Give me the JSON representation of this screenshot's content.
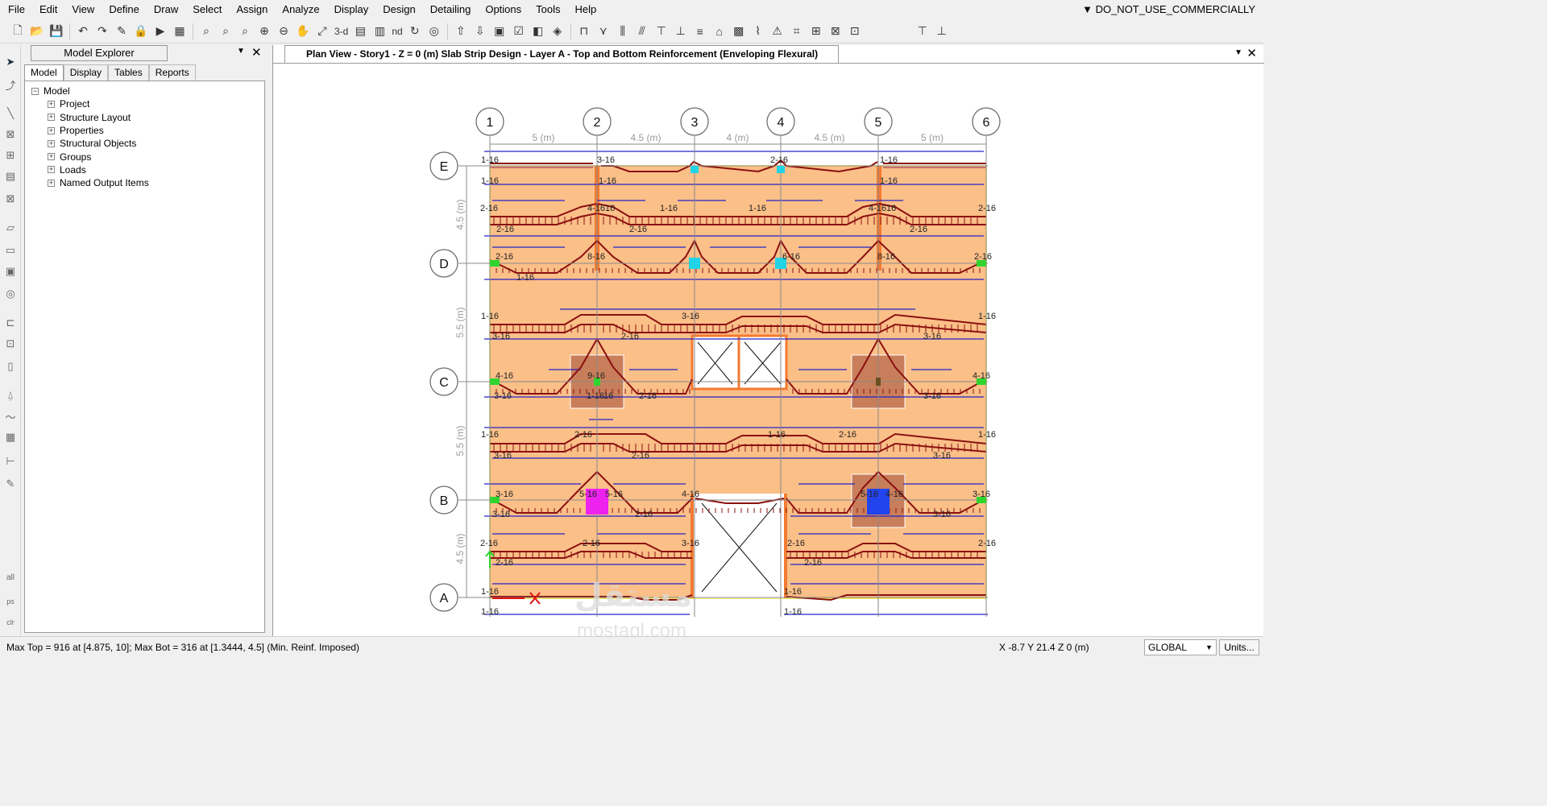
{
  "menu": [
    "File",
    "Edit",
    "View",
    "Define",
    "Draw",
    "Select",
    "Assign",
    "Analyze",
    "Display",
    "Design",
    "Detailing",
    "Options",
    "Tools",
    "Help"
  ],
  "license_notice": "▼ DO_NOT_USE_COMMERCIALLY",
  "toolbar": {
    "view3d_label": "3-d",
    "nd_label": "nd"
  },
  "explorer": {
    "title": "Model Explorer",
    "tabs": [
      "Model",
      "Display",
      "Tables",
      "Reports"
    ],
    "root": "Model",
    "items": [
      "Project",
      "Structure Layout",
      "Properties",
      "Structural Objects",
      "Groups",
      "Loads",
      "Named Output Items"
    ]
  },
  "plan": {
    "title": "Plan View - Story1 - Z = 0 (m)  Slab Strip Design - Layer A - Top and Bottom Reinforcement (Enveloping Flexural)",
    "grid_x": [
      "1",
      "2",
      "3",
      "4",
      "5",
      "6"
    ],
    "grid_y": [
      "E",
      "D",
      "C",
      "B",
      "A"
    ],
    "spans_x": [
      "5 (m)",
      "4.5 (m)",
      "4 (m)",
      "4.5 (m)",
      "5 (m)"
    ],
    "spans_y": [
      "4.5 (m)",
      "5.5 (m)",
      "5.5 (m)",
      "4.5 (m)"
    ],
    "rebar_labels": [
      {
        "id": "e-top-1",
        "t": "1-16"
      },
      {
        "id": "e-top-2",
        "t": "3-16"
      },
      {
        "id": "e-top-4",
        "t": "2-16"
      },
      {
        "id": "e-top-5",
        "t": "1-16"
      },
      {
        "id": "e-bot-1",
        "t": "1-16"
      },
      {
        "id": "e-bot-2",
        "t": "1-16"
      },
      {
        "id": "e-bot-5",
        "t": "1-16"
      },
      {
        "id": "ed-1",
        "t": "2-16"
      },
      {
        "id": "ed-2",
        "t": "4-16"
      },
      {
        "id": "ed-2b",
        "t": "16"
      },
      {
        "id": "ed-3",
        "t": "1-16"
      },
      {
        "id": "ed-4",
        "t": "1-16"
      },
      {
        "id": "ed-5",
        "t": "4-16"
      },
      {
        "id": "ed-5b",
        "t": "16"
      },
      {
        "id": "ed-6",
        "t": "2-16"
      },
      {
        "id": "ed-b1",
        "t": "2-16"
      },
      {
        "id": "ed-b2",
        "t": "2-16"
      },
      {
        "id": "ed-b5",
        "t": "2-16"
      },
      {
        "id": "d-1",
        "t": "2-16"
      },
      {
        "id": "d-2",
        "t": "8-16"
      },
      {
        "id": "d-4",
        "t": "6-16"
      },
      {
        "id": "d-5",
        "t": "8-16"
      },
      {
        "id": "d-6",
        "t": "2-16"
      },
      {
        "id": "d-b1",
        "t": "1-16"
      },
      {
        "id": "dc-1",
        "t": "1-16"
      },
      {
        "id": "dc-3",
        "t": "3-16"
      },
      {
        "id": "dc-6",
        "t": "1-16"
      },
      {
        "id": "dc-b1",
        "t": "3-16"
      },
      {
        "id": "dc-b2",
        "t": "2-16"
      },
      {
        "id": "dc-b5",
        "t": "3-16"
      },
      {
        "id": "c-1",
        "t": "4-16"
      },
      {
        "id": "c-2",
        "t": "9-16"
      },
      {
        "id": "c-6",
        "t": "4-16"
      },
      {
        "id": "c-b1",
        "t": "3-16"
      },
      {
        "id": "c-b2",
        "t": "1-16"
      },
      {
        "id": "c-b2b",
        "t": "16"
      },
      {
        "id": "c-b2c",
        "t": "2-16"
      },
      {
        "id": "c-b5",
        "t": "3-16"
      },
      {
        "id": "cb-1",
        "t": "1-16"
      },
      {
        "id": "cb-2",
        "t": "2-16"
      },
      {
        "id": "cb-4",
        "t": "1-16"
      },
      {
        "id": "cb-5",
        "t": "2-16"
      },
      {
        "id": "cb-6",
        "t": "1-16"
      },
      {
        "id": "cb-b1",
        "t": "3-16"
      },
      {
        "id": "cb-b2",
        "t": "2-16"
      },
      {
        "id": "cb-b5",
        "t": "3-16"
      },
      {
        "id": "b-1",
        "t": "3-16"
      },
      {
        "id": "b-2",
        "t": "5-16"
      },
      {
        "id": "b-2b",
        "t": "5-16"
      },
      {
        "id": "b-3",
        "t": "4-16"
      },
      {
        "id": "b-5",
        "t": "5-16"
      },
      {
        "id": "b-5b",
        "t": "4-16"
      },
      {
        "id": "b-6",
        "t": "3-16"
      },
      {
        "id": "b-b1",
        "t": "3-16"
      },
      {
        "id": "b-b2",
        "t": "2-16"
      },
      {
        "id": "b-b5",
        "t": "3-16"
      },
      {
        "id": "ba-1",
        "t": "2-16"
      },
      {
        "id": "ba-2",
        "t": "2-16"
      },
      {
        "id": "ba-3",
        "t": "3-16"
      },
      {
        "id": "ba-4",
        "t": "2-16"
      },
      {
        "id": "ba-6",
        "t": "2-16"
      },
      {
        "id": "ba-b1",
        "t": "2-16"
      },
      {
        "id": "ba-b4",
        "t": "2-16"
      },
      {
        "id": "a-1",
        "t": "1-16"
      },
      {
        "id": "a-4",
        "t": "1-16"
      },
      {
        "id": "a-b1",
        "t": "1-16"
      },
      {
        "id": "a-b4",
        "t": "1-16"
      }
    ]
  },
  "watermark": {
    "arabic": "مستقل",
    "latin": "mostaql.com"
  },
  "status": {
    "message": "Max Top = 916 at [4.875, 10];  Max Bot = 316 at [1.3444, 4.5]  (Min. Reinf. Imposed)",
    "coords": "X -8.7  Y 21.4  Z 0 (m)",
    "coord_system": "GLOBAL",
    "units_button": "Units..."
  },
  "colors": {
    "slab": "#fbbf88",
    "strip_line": "#2323c8",
    "rebar_diagram": "#8b1010",
    "column": "#f47a30"
  }
}
